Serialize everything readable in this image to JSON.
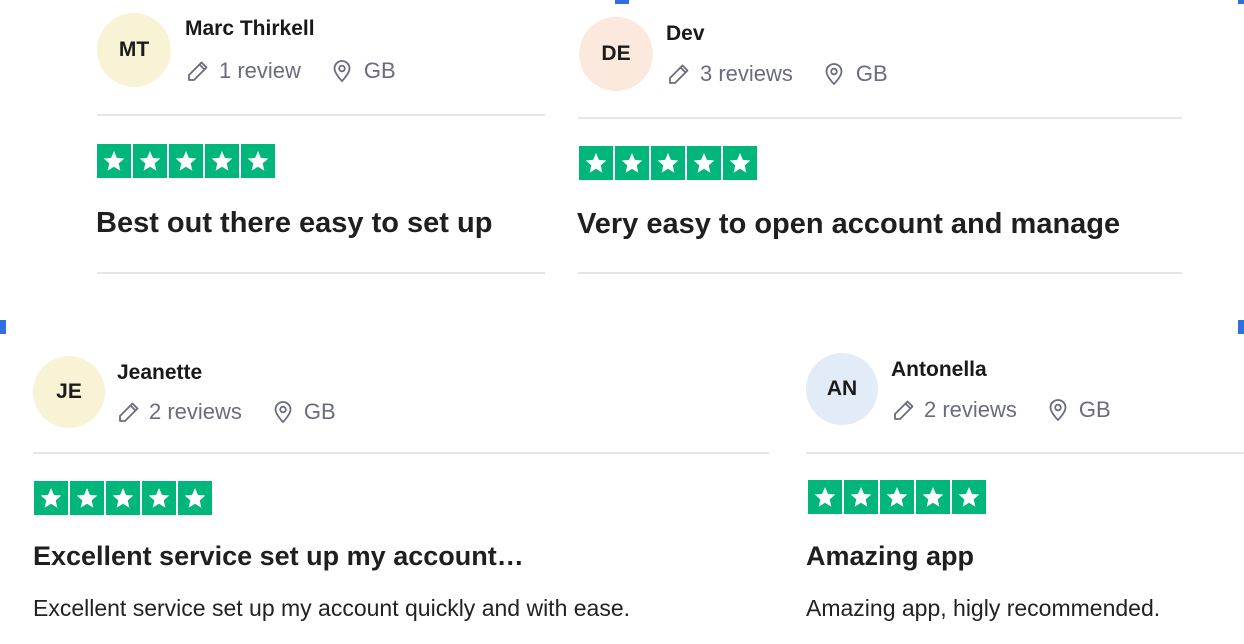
{
  "accent": {
    "star_green": "#00b67a",
    "marker_blue": "#2f6fe0"
  },
  "icons": {
    "reviews": "pencil-icon",
    "location": "location-pin-icon",
    "rating": "star-icon"
  },
  "reviews": [
    {
      "initials": "MT",
      "avatar_color": "#f9f3d6",
      "name": "Marc Thirkell",
      "review_count": "1 review",
      "country": "GB",
      "rating": 5,
      "title": "Best out there easy to set up",
      "text": ""
    },
    {
      "initials": "DE",
      "avatar_color": "#fbe9de",
      "name": "Dev",
      "review_count": "3 reviews",
      "country": "GB",
      "rating": 5,
      "title": "Very easy to open account and manage",
      "text": ""
    },
    {
      "initials": "JE",
      "avatar_color": "#f9f3d6",
      "name": "Jeanette",
      "review_count": "2 reviews",
      "country": "GB",
      "rating": 5,
      "title": "Excellent service set up my account…",
      "text": "Excellent service set up my account quickly and with ease."
    },
    {
      "initials": "AN",
      "avatar_color": "#e2ecf8",
      "name": "Antonella",
      "review_count": "2 reviews",
      "country": "GB",
      "rating": 5,
      "title": "Amazing app",
      "text": "Amazing app, higly recommended."
    }
  ]
}
